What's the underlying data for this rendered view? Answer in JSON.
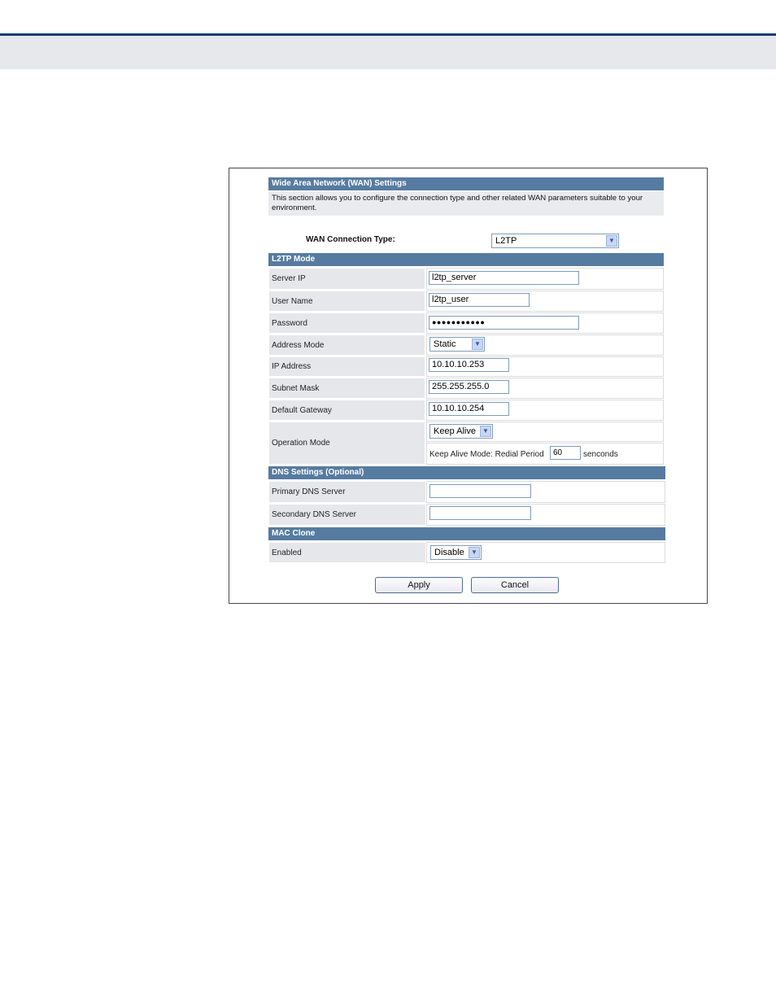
{
  "wan": {
    "title": "Wide Area Network (WAN) Settings",
    "description": "This section allows you to configure the connection type and other related WAN parameters suitable to your environment.",
    "connection_type_label": "WAN Connection Type:",
    "connection_type_value": "L2TP"
  },
  "l2tp": {
    "header": "L2TP Mode",
    "server_ip_label": "Server IP",
    "server_ip_value": "l2tp_server",
    "user_name_label": "User Name",
    "user_name_value": "l2tp_user",
    "password_label": "Password",
    "password_value": "●●●●●●●●●●●",
    "address_mode_label": "Address Mode",
    "address_mode_value": "Static",
    "ip_address_label": "IP Address",
    "ip_address_value": "10.10.10.253",
    "subnet_mask_label": "Subnet Mask",
    "subnet_mask_value": "255.255.255.0",
    "default_gateway_label": "Default Gateway",
    "default_gateway_value": "10.10.10.254",
    "operation_mode_label": "Operation Mode",
    "operation_mode_value": "Keep Alive",
    "redial_label": "Keep Alive Mode: Redial Period",
    "redial_value": "60",
    "redial_unit": "senconds"
  },
  "dns": {
    "header": "DNS Settings (Optional)",
    "primary_label": "Primary DNS Server",
    "primary_value": "",
    "secondary_label": "Secondary DNS Server",
    "secondary_value": ""
  },
  "mac": {
    "header": "MAC Clone",
    "enabled_label": "Enabled",
    "enabled_value": "Disable"
  },
  "buttons": {
    "apply": "Apply",
    "cancel": "Cancel"
  },
  "colors": {
    "section_header": "#567ba0",
    "top_rule": "#1f3b72",
    "label_cell": "#e6e7ea"
  }
}
